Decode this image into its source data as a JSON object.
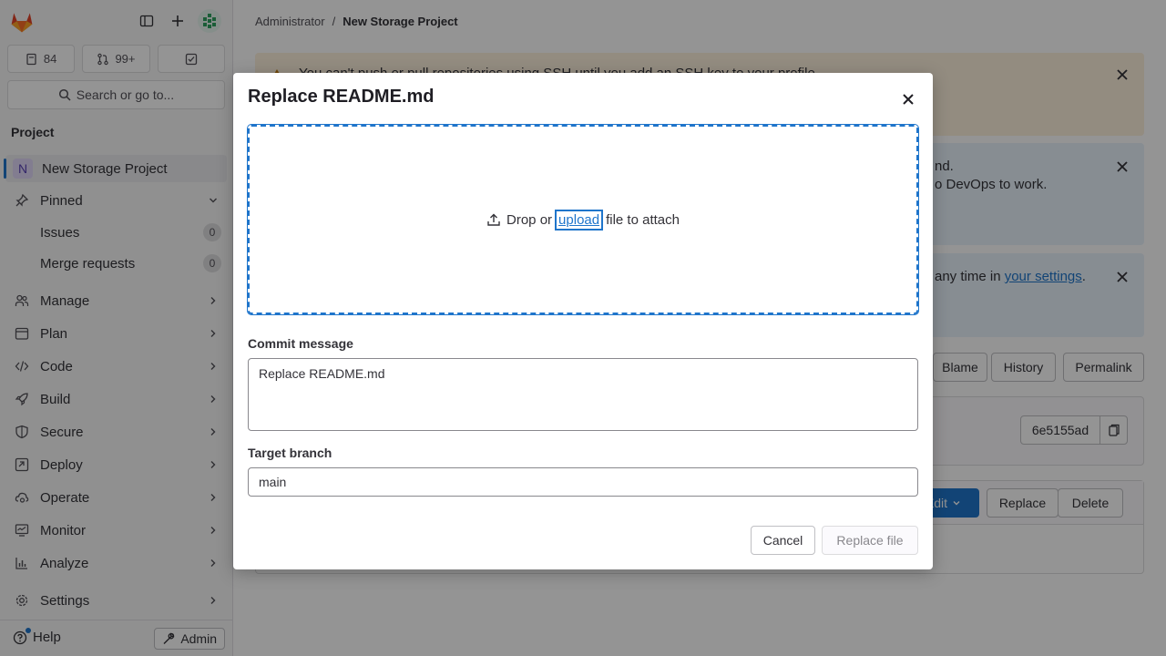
{
  "sidebar": {
    "counts": {
      "issues": "84",
      "merge_requests": "99+"
    },
    "search_label": "Search or go to...",
    "section_title": "Project",
    "project_name": "New Storage Project",
    "project_initial": "N",
    "pinned_label": "Pinned",
    "pinned_items": [
      {
        "label": "Issues",
        "count": "0"
      },
      {
        "label": "Merge requests",
        "count": "0"
      }
    ],
    "nav": [
      {
        "label": "Manage",
        "icon": "users-icon"
      },
      {
        "label": "Plan",
        "icon": "calendar-icon"
      },
      {
        "label": "Code",
        "icon": "code-icon"
      },
      {
        "label": "Build",
        "icon": "rocket-icon"
      },
      {
        "label": "Secure",
        "icon": "shield-icon"
      },
      {
        "label": "Deploy",
        "icon": "deploy-icon"
      },
      {
        "label": "Operate",
        "icon": "cloud-gear-icon"
      },
      {
        "label": "Monitor",
        "icon": "monitor-icon"
      },
      {
        "label": "Analyze",
        "icon": "chart-icon"
      },
      {
        "label": "Settings",
        "icon": "gear-icon"
      }
    ],
    "help_label": "Help",
    "admin_label": "Admin"
  },
  "breadcrumb": {
    "parent": "Administrator",
    "separator": "/",
    "current": "New Storage Project"
  },
  "background": {
    "alert_warn_text": "You can't push or pull repositories using SSH until you add an SSH key to your profile.",
    "alert_info1_line1": "nd.",
    "alert_info1_line2": "o DevOps to work.",
    "alert_info2_text": "any time in",
    "alert_info2_link": "your settings",
    "alert_info2_end": ".",
    "file_buttons": {
      "blame": "Blame",
      "history": "History",
      "permalink": "Permalink"
    },
    "commit_sha": "6e5155ad",
    "blob_buttons": {
      "edit": "Edit",
      "replace": "Replace",
      "delete": "Delete"
    }
  },
  "modal": {
    "title": "Replace README.md",
    "drop_prefix": "Drop or",
    "drop_link": "upload",
    "drop_suffix": "file to attach",
    "commit_label": "Commit message",
    "commit_value": "Replace README.md",
    "branch_label": "Target branch",
    "branch_value": "main",
    "cancel_label": "Cancel",
    "submit_label": "Replace file"
  },
  "colors": {
    "accent": "#1f75cb",
    "warning_bg": "#fdf1dd",
    "info_bg": "#e9f3fc"
  }
}
